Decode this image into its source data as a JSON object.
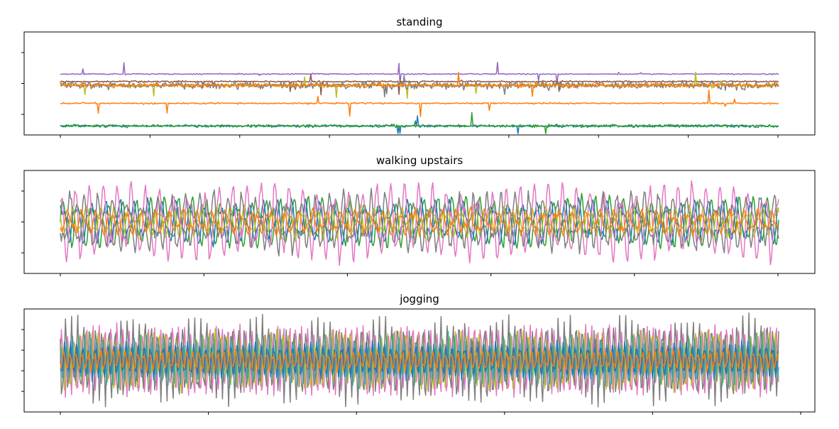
{
  "chart_data": [
    {
      "type": "line",
      "title": "standing",
      "xlabel": "",
      "ylabel": "",
      "grid": false,
      "legend": "none",
      "x_ticks": 9,
      "y_ticks": 3,
      "kind": "steady",
      "series": [
        {
          "color": "#9467bd",
          "level": 0.6,
          "noise": 0.003
        },
        {
          "color": "#8c564b",
          "level": 0.52,
          "noise": 0.004
        },
        {
          "color": "#ff7f0e",
          "level": 0.29,
          "noise": 0.004
        },
        {
          "color": "#1f77b4",
          "level": 0.05,
          "noise": 0.006
        },
        {
          "color": "#2ca02c",
          "level": 0.05,
          "noise": 0.008
        },
        {
          "color": "#bcbd22",
          "level": 0.48,
          "noise": 0.01
        },
        {
          "color": "#7f7f7f",
          "level": 0.48,
          "noise": 0.02
        },
        {
          "color": "#ff7f0e",
          "level": 0.48,
          "noise": 0.012
        }
      ]
    },
    {
      "type": "line",
      "title": "walking upstairs",
      "xlabel": "",
      "ylabel": "",
      "grid": false,
      "legend": "none",
      "x_ticks": 6,
      "y_ticks": 3,
      "kind": "periodic",
      "period": 14,
      "series": [
        {
          "color": "#2ca02c",
          "amp": 0.25,
          "noise": 0.05
        },
        {
          "color": "#1f77b4",
          "amp": 0.22,
          "noise": 0.05
        },
        {
          "color": "#e377c2",
          "amp": 0.38,
          "noise": 0.08
        },
        {
          "color": "#bcbd22",
          "amp": 0.15,
          "noise": 0.05
        },
        {
          "color": "#7f7f7f",
          "amp": 0.28,
          "noise": 0.1
        },
        {
          "color": "#ff7f0e",
          "amp": 0.12,
          "noise": 0.05
        }
      ]
    },
    {
      "type": "line",
      "title": "jogging",
      "xlabel": "",
      "ylabel": "",
      "grid": false,
      "legend": "none",
      "x_ticks": 6,
      "y_ticks": 4,
      "kind": "periodic",
      "period": 6,
      "series": [
        {
          "color": "#e377c2",
          "amp": 0.36,
          "noise": 0.06
        },
        {
          "color": "#bcbd22",
          "amp": 0.3,
          "noise": 0.05
        },
        {
          "color": "#17becf",
          "amp": 0.25,
          "noise": 0.05
        },
        {
          "color": "#7f7f7f",
          "amp": 0.42,
          "noise": 0.1
        },
        {
          "color": "#1f77b4",
          "amp": 0.18,
          "noise": 0.04
        },
        {
          "color": "#ff7f0e",
          "amp": 0.1,
          "noise": 0.04
        }
      ]
    }
  ]
}
